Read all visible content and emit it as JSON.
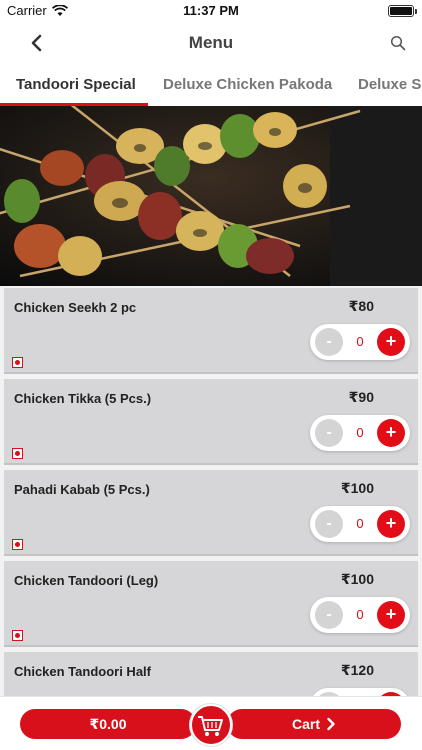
{
  "status_bar": {
    "carrier": "Carrier",
    "time": "11:37 PM"
  },
  "nav": {
    "title": "Menu",
    "back_icon": "chevron-left-icon",
    "search_icon": "search-icon"
  },
  "tabs": [
    {
      "label": "Tandoori Special",
      "active": true
    },
    {
      "label": "Deluxe Chicken Pakoda",
      "active": false
    },
    {
      "label": "Deluxe Special",
      "active": false
    }
  ],
  "items": [
    {
      "name": "Chicken Seekh 2 pc",
      "price": "₹80",
      "qty": "0",
      "minus": "-",
      "plus": "+"
    },
    {
      "name": "Chicken Tikka (5 Pcs.)",
      "price": "₹90",
      "qty": "0",
      "minus": "-",
      "plus": "+"
    },
    {
      "name": "Pahadi Kabab (5 Pcs.)",
      "price": "₹100",
      "qty": "0",
      "minus": "-",
      "plus": "+"
    },
    {
      "name": "Chicken Tandoori (Leg)",
      "price": "₹100",
      "qty": "0",
      "minus": "-",
      "plus": "+"
    },
    {
      "name": "Chicken Tandoori Half",
      "price": "₹120",
      "qty": "0",
      "minus": "-",
      "plus": "+"
    }
  ],
  "bottom_bar": {
    "total": "₹0.00",
    "cart_label": "Cart",
    "cart_icon": "shopping-cart-icon"
  },
  "colors": {
    "accent": "#d8101c",
    "item_bg": "#d6d6d8",
    "stepper_minus": "#d4d4d4"
  }
}
